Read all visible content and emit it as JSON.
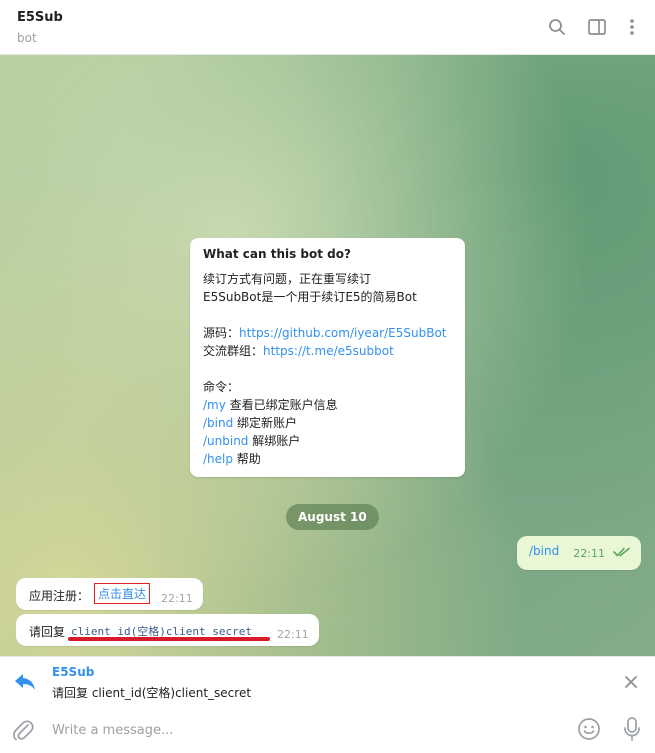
{
  "header": {
    "title": "E5Sub",
    "subtitle": "bot"
  },
  "info_card": {
    "title": "What can this bot do?",
    "lines": [
      "续订方式有问题，正在重写续订",
      "E5SubBot是一个用于续订E5的简易Bot"
    ],
    "source_label": "源码：",
    "source_link": "https://github.com/iyear/E5SubBot",
    "group_label": "交流群组：",
    "group_link": "https://t.me/e5subbot",
    "commands_label": "命令：",
    "commands": [
      {
        "cmd": "/my",
        "desc": " 查看已绑定账户信息"
      },
      {
        "cmd": "/bind",
        "desc": "  绑定新账户"
      },
      {
        "cmd": "/unbind",
        "desc": " 解绑账户"
      },
      {
        "cmd": "/help",
        "desc": " 帮助"
      }
    ]
  },
  "date_separator": "August 10",
  "messages": {
    "outgoing": {
      "text": "/bind",
      "time": "22:11"
    },
    "incoming_1": {
      "text": "应用注册：",
      "link": "点击直达",
      "time": "22:11"
    },
    "incoming_2": {
      "text": "请回复",
      "code": "client_id(空格)client_secret",
      "time": "22:11"
    }
  },
  "reply": {
    "name": "E5Sub",
    "text": "请回复 client_id(空格)client_secret"
  },
  "composer": {
    "placeholder": "Write a message..."
  },
  "colors": {
    "accent": "#3390ec",
    "highlight_red": "#d81b2a"
  }
}
